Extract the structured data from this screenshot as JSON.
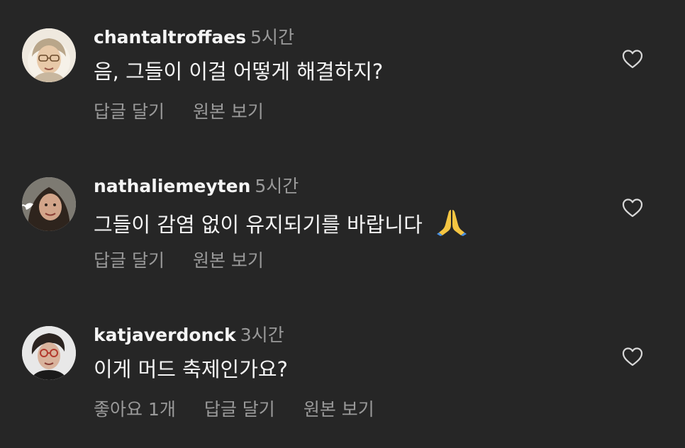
{
  "comments": [
    {
      "username": "chantaltroffaes",
      "time": "5시간",
      "text": "음, 그들이 이걸 어떻게 해결하지?",
      "actions": [
        "답글 달기",
        "원본 보기"
      ]
    },
    {
      "username": "nathaliemeyten",
      "time": "5시간",
      "text": "그들이 감염 없이 유지되기를 바랍니다",
      "emoji": "🙏",
      "actions": [
        "답글 달기",
        "원본 보기"
      ]
    },
    {
      "username": "katjaverdonck",
      "time": "3시간",
      "text": "이게 머드 축제인가요?",
      "actions": [
        "좋아요 1개",
        "답글 달기",
        "원본 보기"
      ]
    }
  ],
  "icons": {
    "like": "heart-outline-icon",
    "emoji": "folded-hands-emoji"
  },
  "colors": {
    "background": "#262626",
    "primary_text": "#f5f5f5",
    "secondary_text": "#9a9a9a"
  }
}
